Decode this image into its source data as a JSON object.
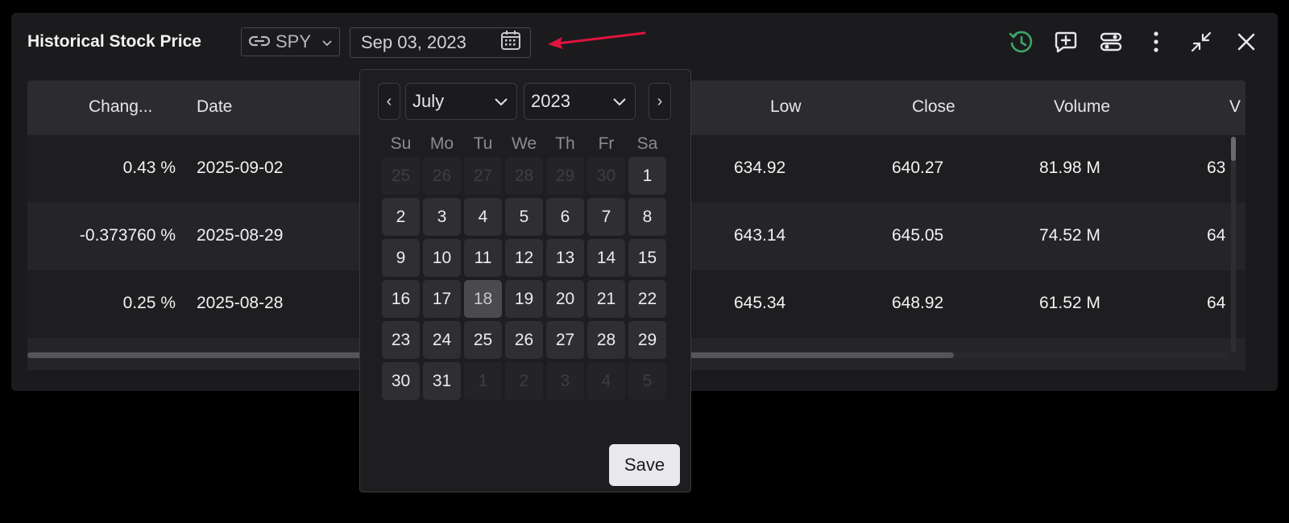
{
  "widget": {
    "title": "Historical Stock Price",
    "ticker": "SPY",
    "date_value": "Sep 03, 2023"
  },
  "actions": [
    "history-icon",
    "add-comment-icon",
    "settings-sliders-icon",
    "more-vertical-icon",
    "minimize-icon",
    "close-icon"
  ],
  "colors": {
    "history_icon": "#3fa56a",
    "arrow": "#e0123f",
    "background": "#000000",
    "panel": "#1b1b1d"
  },
  "table": {
    "columns": [
      "Chang...",
      "Date",
      "Low",
      "Close",
      "Volume",
      "V"
    ],
    "rows": [
      {
        "change": "0.43 %",
        "date": "2025-09-02",
        "low": "634.92",
        "close": "640.27",
        "volume": "81.98 M",
        "v": "63"
      },
      {
        "change": "-0.373760 %",
        "date": "2025-08-29",
        "low": "643.14",
        "close": "645.05",
        "volume": "74.52 M",
        "v": "64"
      },
      {
        "change": "0.25 %",
        "date": "2025-08-28",
        "low": "645.34",
        "close": "648.92",
        "volume": "61.52 M",
        "v": "64"
      }
    ]
  },
  "calendar": {
    "prev": "‹",
    "next": "›",
    "month": "July",
    "year": "2023",
    "weekdays": [
      "Su",
      "Mo",
      "Tu",
      "We",
      "Th",
      "Fr",
      "Sa"
    ],
    "days": [
      {
        "d": "25",
        "m": true
      },
      {
        "d": "26",
        "m": true
      },
      {
        "d": "27",
        "m": true
      },
      {
        "d": "28",
        "m": true
      },
      {
        "d": "29",
        "m": true
      },
      {
        "d": "30",
        "m": true
      },
      {
        "d": "1"
      },
      {
        "d": "2"
      },
      {
        "d": "3"
      },
      {
        "d": "4"
      },
      {
        "d": "5"
      },
      {
        "d": "6"
      },
      {
        "d": "7"
      },
      {
        "d": "8"
      },
      {
        "d": "9"
      },
      {
        "d": "10"
      },
      {
        "d": "11"
      },
      {
        "d": "12"
      },
      {
        "d": "13"
      },
      {
        "d": "14"
      },
      {
        "d": "15"
      },
      {
        "d": "16"
      },
      {
        "d": "17"
      },
      {
        "d": "18",
        "s": true
      },
      {
        "d": "19"
      },
      {
        "d": "20"
      },
      {
        "d": "21"
      },
      {
        "d": "22"
      },
      {
        "d": "23"
      },
      {
        "d": "24"
      },
      {
        "d": "25"
      },
      {
        "d": "26"
      },
      {
        "d": "27"
      },
      {
        "d": "28"
      },
      {
        "d": "29"
      },
      {
        "d": "30"
      },
      {
        "d": "31"
      },
      {
        "d": "1",
        "m": true
      },
      {
        "d": "2",
        "m": true
      },
      {
        "d": "3",
        "m": true
      },
      {
        "d": "4",
        "m": true
      },
      {
        "d": "5",
        "m": true
      }
    ],
    "save_label": "Save"
  }
}
